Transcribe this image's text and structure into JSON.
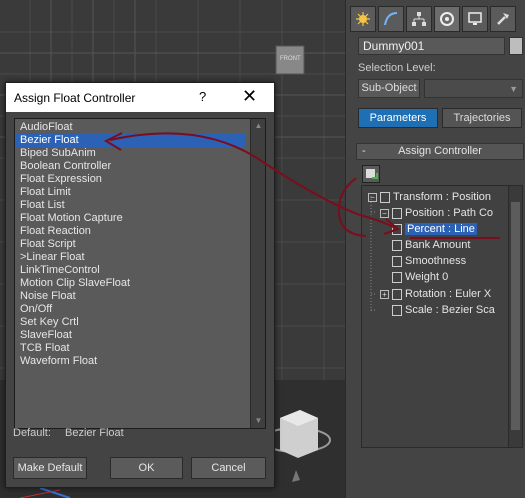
{
  "viewport": {
    "gizmo_label": "FRONT"
  },
  "command_panel": {
    "tabs": [
      "create-icon",
      "modify-icon",
      "hierarchy-icon",
      "motion-icon",
      "display-icon",
      "utilities-icon"
    ],
    "object_name": "Dummy001",
    "selection_level_label": "Selection Level:",
    "subobject_button": "Sub-Object",
    "parameters_tab": "Parameters",
    "trajectories_tab": "Trajectories",
    "rollout_toggle": "-",
    "rollout_title": "Assign Controller",
    "tree": [
      {
        "label": "Transform : Position",
        "indent": 0
      },
      {
        "label": "Position : Path Co",
        "indent": 1
      },
      {
        "label": "Percent : Line",
        "indent": 2,
        "selected": true
      },
      {
        "label": "Bank Amount",
        "indent": 2
      },
      {
        "label": "Smoothness",
        "indent": 2
      },
      {
        "label": "Weight 0",
        "indent": 2
      },
      {
        "label": "Rotation : Euler X",
        "indent": 1
      },
      {
        "label": "Scale : Bezier Sca",
        "indent": 1
      }
    ],
    "colors": {
      "accent": "#1f6fb5",
      "selection": "#2c62b5"
    }
  },
  "dialog": {
    "title": "Assign Float Controller",
    "help_label": "?",
    "close_label": "✕",
    "items": [
      "AudioFloat",
      "Bezier Float",
      "Biped SubAnim",
      "Boolean Controller",
      "Float Expression",
      "Float Limit",
      "Float List",
      "Float Motion Capture",
      "Float Reaction",
      "Float Script",
      ">Linear Float",
      "LinkTimeControl",
      "Motion Clip SlaveFloat",
      "Noise Float",
      "On/Off",
      "Set Key Crtl",
      "SlaveFloat",
      "TCB Float",
      "Waveform Float"
    ],
    "selected_item": "Bezier Float",
    "default_label": "Default:",
    "default_value": "Bezier Float",
    "make_default_button": "Make Default",
    "ok_button": "OK",
    "cancel_button": "Cancel"
  },
  "annotation_color": "#7a0e1e"
}
